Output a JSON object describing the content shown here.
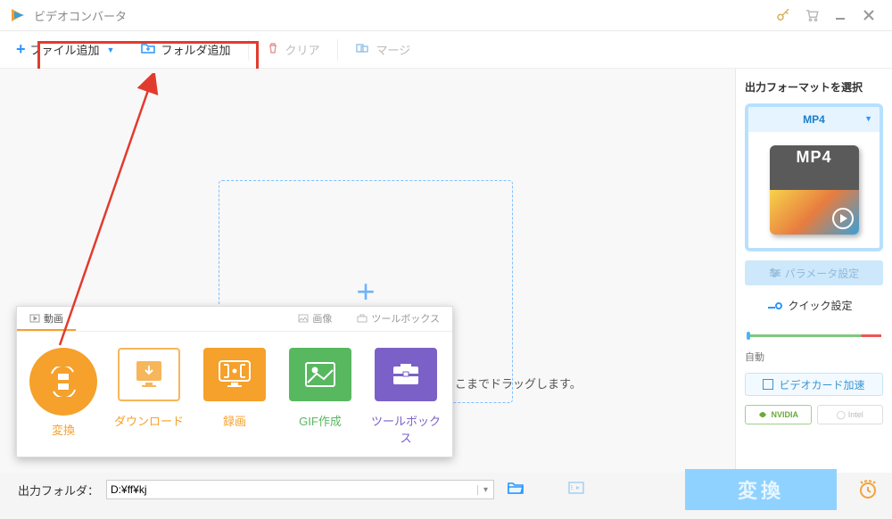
{
  "titlebar": {
    "title": "ビデオコンバータ"
  },
  "toolbar": {
    "addfile": "ファイル追加",
    "addfolder": "フォルダ追加",
    "clear": "クリア",
    "merge": "マージ"
  },
  "drop_hint": "こまでドラッグします。",
  "right": {
    "heading": "出力フォーマットを選択",
    "format_selected": "MP4",
    "thumb_label": "MP4",
    "param": "パラメータ設定",
    "quick": "クイック設定",
    "auto": "自動",
    "gpu": "ビデオカード加速",
    "gpu_nvidia": "NVIDIA",
    "gpu_intel": "Intel"
  },
  "popup": {
    "tabs": {
      "video": "動画",
      "image": "画像",
      "toolbox": "ツールボックス"
    },
    "items": {
      "convert": "変換",
      "download": "ダウンロード",
      "record": "録画",
      "gif": "GIF作成",
      "toolbox": "ツールボックス"
    }
  },
  "bottom": {
    "out_label": "出力フォルダ：",
    "out_path": "D:¥ff¥kj",
    "convert": "変換"
  }
}
